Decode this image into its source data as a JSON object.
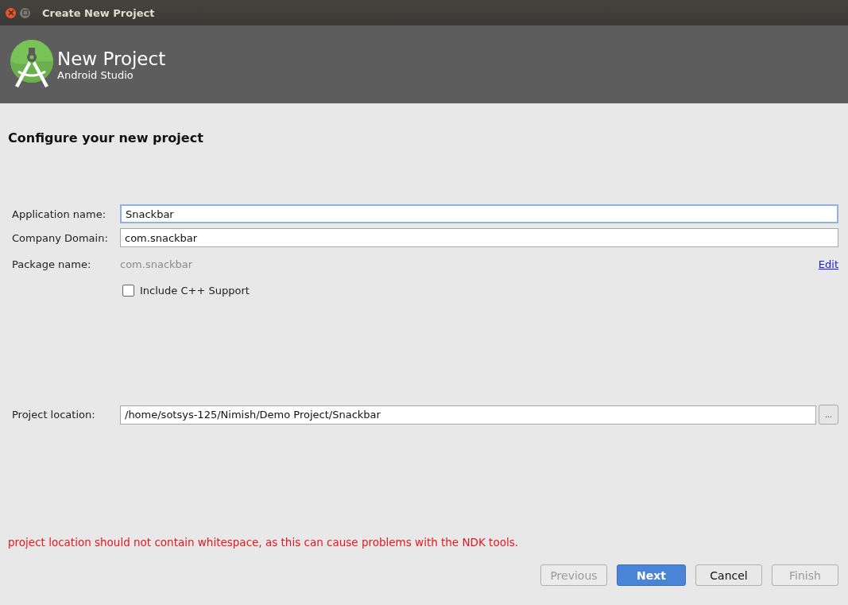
{
  "window": {
    "title": "Create New Project"
  },
  "header": {
    "title": "New Project",
    "subtitle": "Android Studio"
  },
  "heading": "Configure your new project",
  "fields": [
    {
      "label": "Application name:",
      "value": "Snackbar",
      "focused": true
    },
    {
      "label": "Company Domain:",
      "value": "com.snackbar",
      "focused": false
    }
  ],
  "package": {
    "label": "Package name:",
    "value": "com.snackbar",
    "link": "Edit"
  },
  "cpp_support": {
    "label": "Include C++ Support",
    "checked": false
  },
  "location": {
    "label": "Project location:",
    "value": "/home/sotsys-125/Nimish/Demo Project/Snackbar",
    "browse": "..."
  },
  "error": "project location should not contain whitespace, as this can cause problems with the NDK tools.",
  "buttons": [
    {
      "label": "Previous",
      "kind": "normal",
      "disabled": true
    },
    {
      "label": "Next",
      "kind": "default",
      "disabled": false
    },
    {
      "label": "Cancel",
      "kind": "normal",
      "disabled": false
    },
    {
      "label": "Finish",
      "kind": "normal",
      "disabled": true
    }
  ]
}
